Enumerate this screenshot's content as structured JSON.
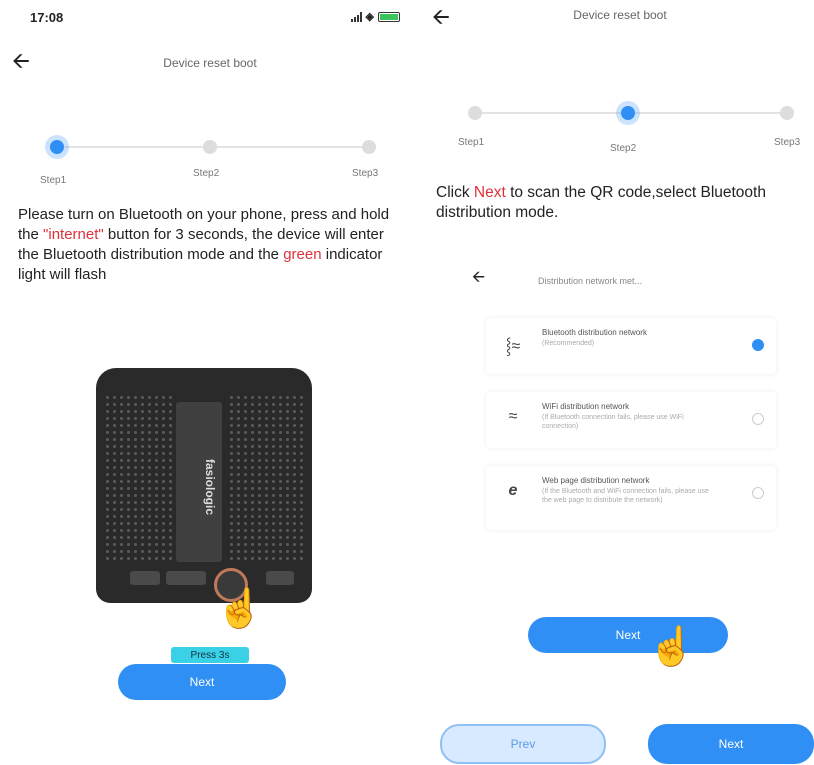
{
  "status_bar": {
    "time": "17:08"
  },
  "left_panel": {
    "title": "Device reset boot",
    "steps": [
      "Step1",
      "Step2",
      "Step3"
    ],
    "instruction": {
      "part1": "Please turn on Bluetooth on your phone, press and hold the ",
      "internet": "\"internet\"",
      "part2": " button for 3 seconds, the device will enter the Bluetooth distribution mode and the ",
      "green": "green",
      "part3": " indicator light will flash"
    },
    "device_brand": "fasiologic",
    "press_label": "Press 3s",
    "next_label": "Next"
  },
  "right_panel": {
    "title": "Device reset boot",
    "steps": [
      "Step1",
      "Step2",
      "Step3"
    ],
    "instruction": {
      "part1": "Click ",
      "next": "Next",
      "part2": " to scan the QR code,select Bluetooth distribution mode."
    },
    "sub_screen": {
      "title": "Distribution network met...",
      "options": [
        {
          "icon": "bluetooth-icon",
          "title": "Bluetooth distribution network",
          "subtitle": "(Recommended)",
          "selected": true
        },
        {
          "icon": "wifi-icon",
          "title": "WiFi distribution network",
          "subtitle": "(If Bluetooth connection fails, please use WiFi connection)",
          "selected": false
        },
        {
          "icon": "browser-icon",
          "title": "Web page distribution network",
          "subtitle": "(If the Bluetooth and WiFi connection fails, please use the web page to distribute the network)",
          "selected": false
        }
      ],
      "next_label": "Next"
    },
    "prev_label": "Prev",
    "next_label": "Next"
  },
  "colors": {
    "accent": "#2f8ff5",
    "highlight": "#e0313a",
    "light_accent": "#d7eaff"
  }
}
